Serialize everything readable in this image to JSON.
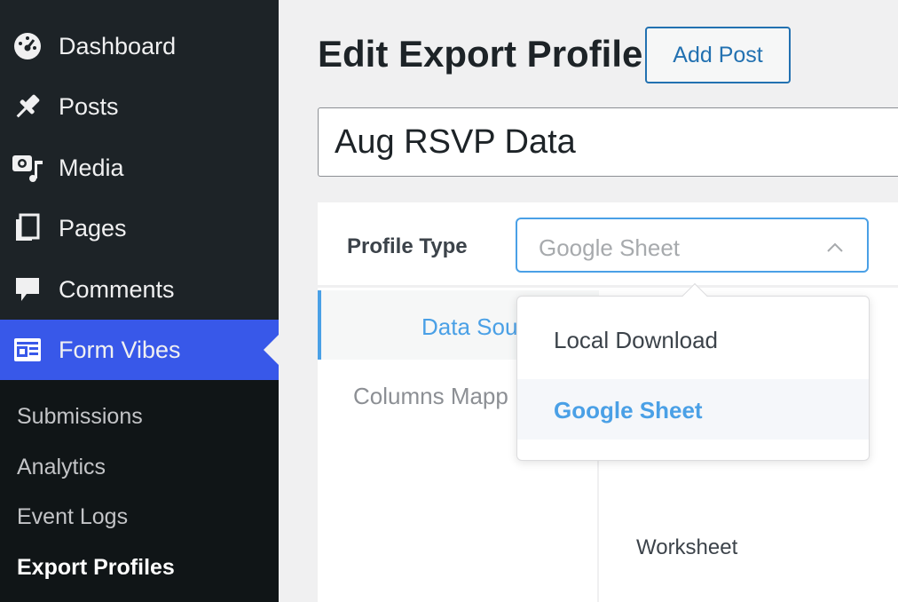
{
  "sidebar": {
    "items": [
      {
        "label": "Dashboard",
        "icon": "dashboard-icon"
      },
      {
        "label": "Posts",
        "icon": "pin-icon"
      },
      {
        "label": "Media",
        "icon": "media-icon"
      },
      {
        "label": "Pages",
        "icon": "pages-icon"
      },
      {
        "label": "Comments",
        "icon": "comment-icon"
      },
      {
        "label": "Form Vibes",
        "icon": "form-vibes-icon"
      }
    ],
    "submenu": [
      "Submissions",
      "Analytics",
      "Event Logs",
      "Export Profiles"
    ]
  },
  "header": {
    "title": "Edit Export Profile",
    "add_post_label": "Add Post"
  },
  "profile_title": "Aug RSVP Data",
  "profile_type": {
    "label": "Profile Type",
    "selected": "Google Sheet"
  },
  "tabs": [
    "Data Sou",
    "Columns Mapp"
  ],
  "fields": [
    "Worksheet"
  ],
  "dropdown": {
    "options": [
      "Local Download",
      "Google Sheet"
    ]
  },
  "colors": {
    "sidebar_bg": "#1d2327",
    "accent": "#3858e9",
    "link_blue": "#4aa0e6",
    "button_blue": "#2271b1"
  }
}
